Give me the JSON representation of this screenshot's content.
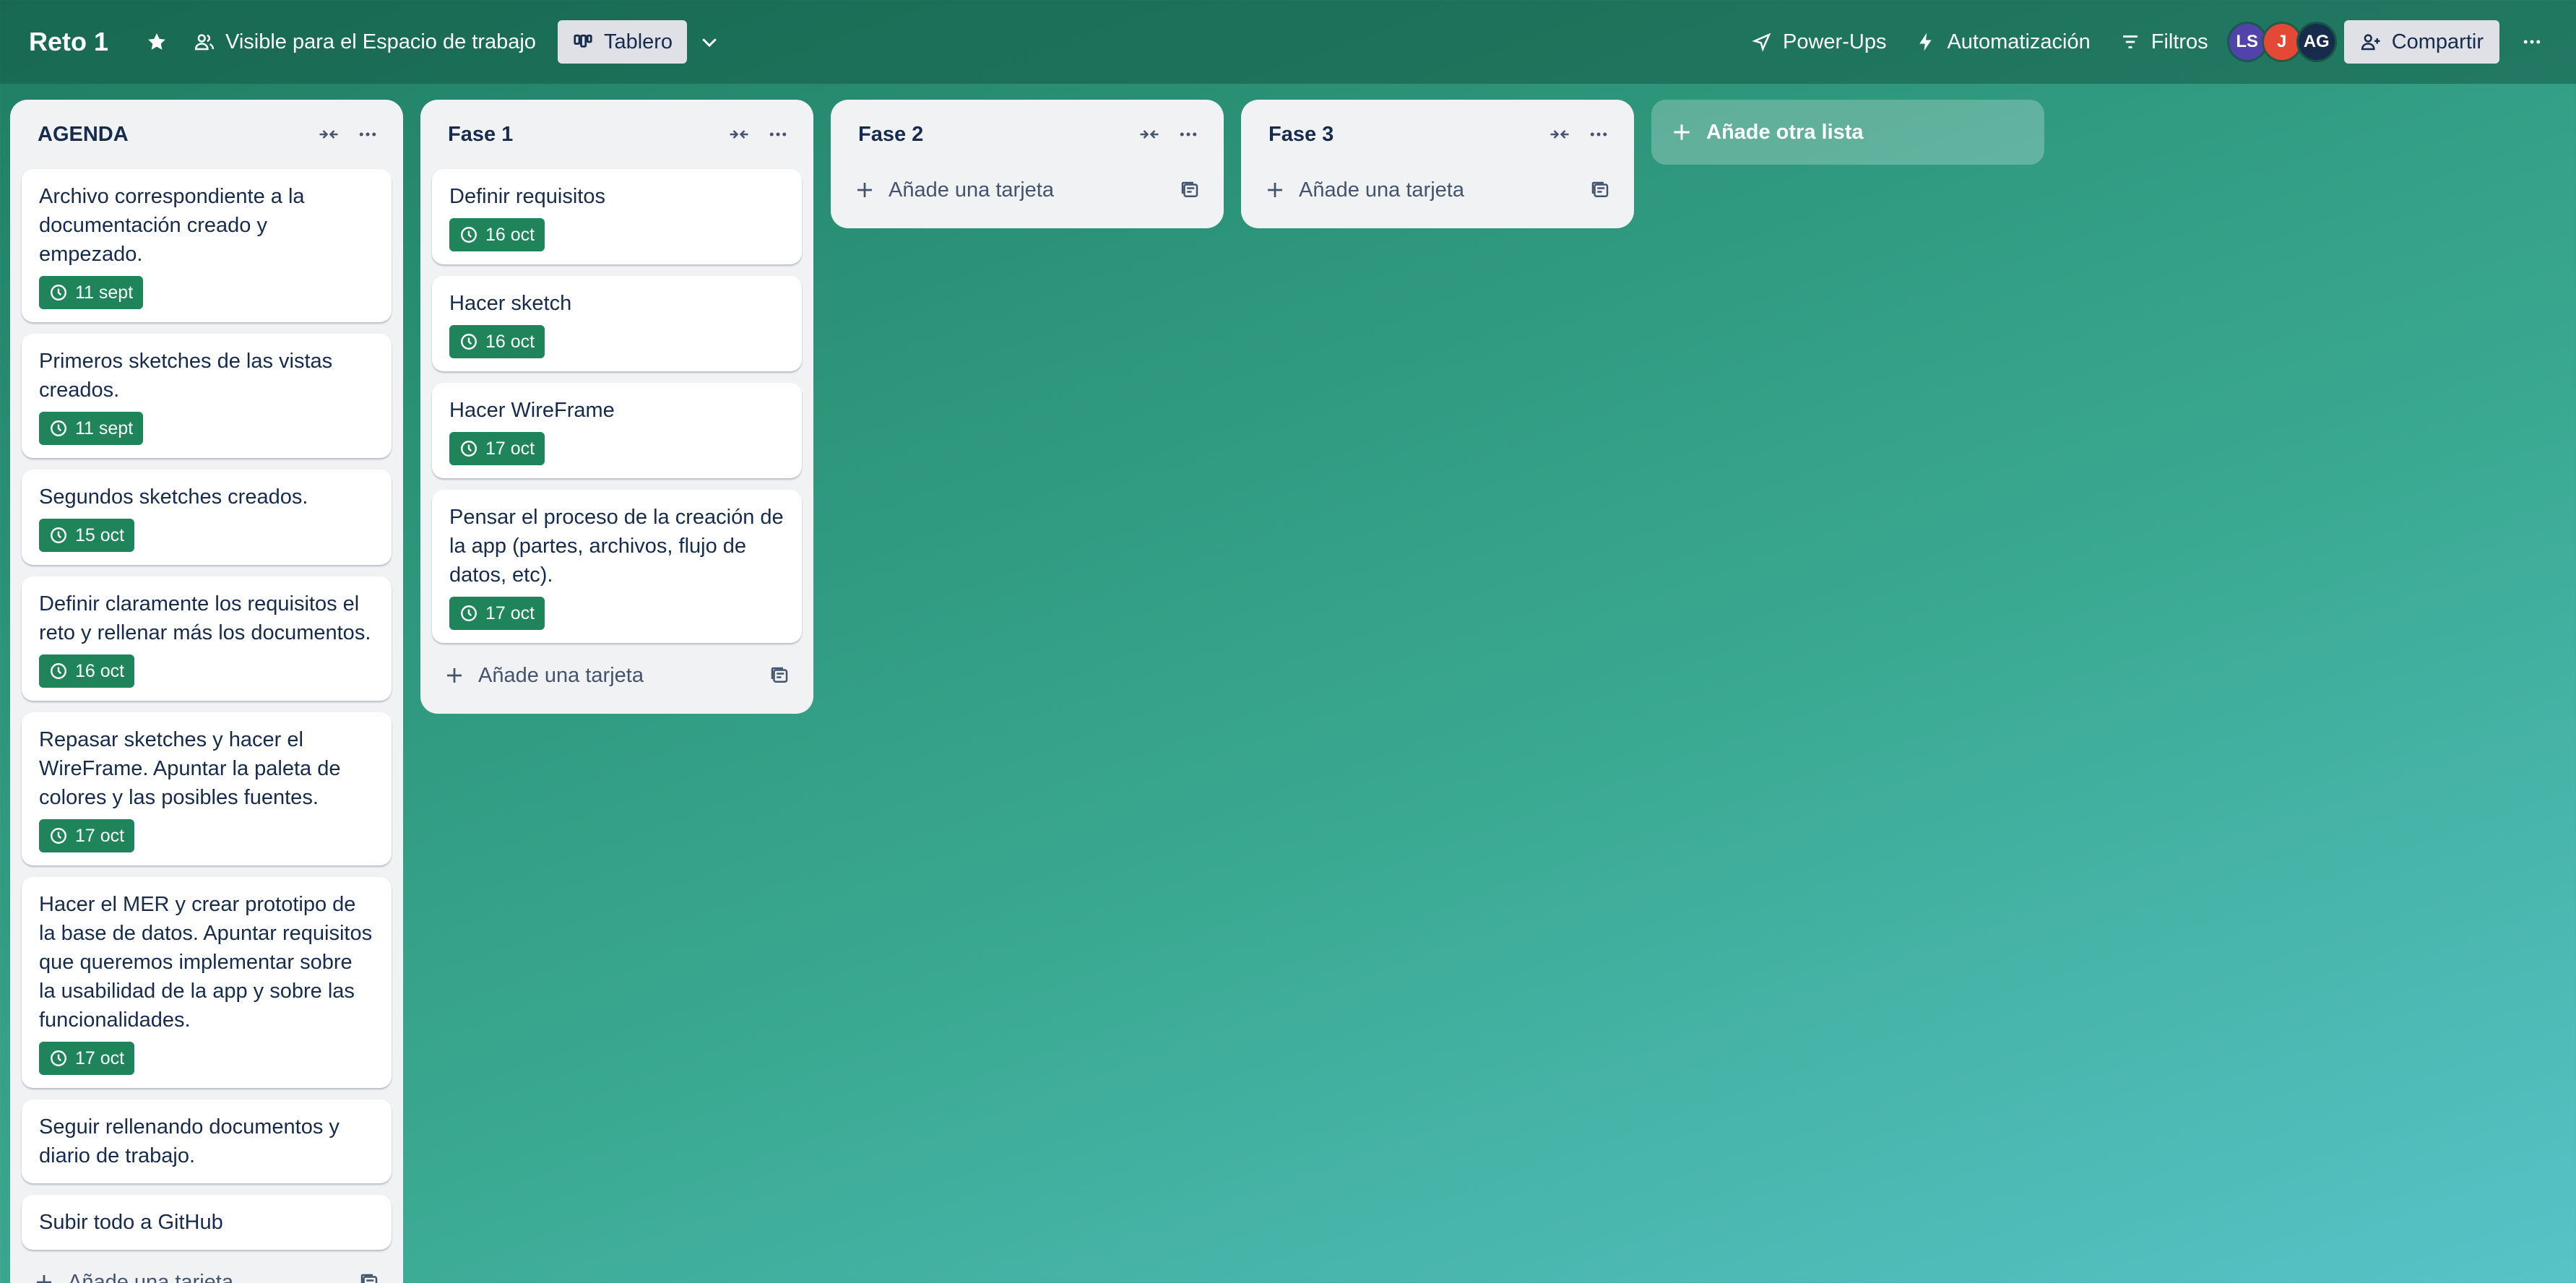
{
  "header": {
    "title": "Reto 1",
    "star_icon": "star-icon",
    "visibility_label": "Visible para el Espacio de trabajo",
    "view_label": "Tablero",
    "powerups_label": "Power-Ups",
    "automation_label": "Automatización",
    "filters_label": "Filtros",
    "share_label": "Compartir",
    "members": [
      {
        "initials": "LS",
        "color": "#5243aa"
      },
      {
        "initials": "J",
        "color": "#e34935"
      },
      {
        "initials": "AG",
        "color": "#172b4d"
      }
    ]
  },
  "lists": [
    {
      "title": "AGENDA",
      "add_card_label": "Añade una tarjeta",
      "cards": [
        {
          "text": "Archivo correspondiente a la documentación creado y empezado.",
          "due": "11 sept"
        },
        {
          "text": "Primeros sketches de las vistas creados.",
          "due": "11 sept"
        },
        {
          "text": "Segundos sketches creados.",
          "due": "15 oct"
        },
        {
          "text": "Definir claramente los requisitos el reto y rellenar más los documentos.",
          "due": "16 oct"
        },
        {
          "text": "Repasar sketches y hacer el WireFrame. Apuntar la paleta de colores y las posibles fuentes.",
          "due": "17 oct"
        },
        {
          "text": "Hacer el MER y crear prototipo de la base de datos. Apuntar requisitos que queremos implementar sobre la usabilidad de la app y sobre las funcionalidades.",
          "due": "17 oct"
        },
        {
          "text": "Seguir rellenando documentos y diario de trabajo.",
          "due": ""
        },
        {
          "text": "Subir todo a GitHub",
          "due": ""
        }
      ]
    },
    {
      "title": "Fase 1",
      "add_card_label": "Añade una tarjeta",
      "cards": [
        {
          "text": "Definir requisitos",
          "due": "16 oct"
        },
        {
          "text": "Hacer sketch",
          "due": "16 oct"
        },
        {
          "text": "Hacer WireFrame",
          "due": "17 oct"
        },
        {
          "text": "Pensar el proceso de la creación de la app (partes, archivos, flujo de datos, etc).",
          "due": "17 oct"
        }
      ]
    },
    {
      "title": "Fase 2",
      "add_card_label": "Añade una tarjeta",
      "cards": []
    },
    {
      "title": "Fase 3",
      "add_card_label": "Añade una tarjeta",
      "cards": []
    }
  ],
  "add_list_label": "Añade otra lista",
  "colors": {
    "due_badge": "#1f845a",
    "list_bg": "#f1f2f4"
  }
}
